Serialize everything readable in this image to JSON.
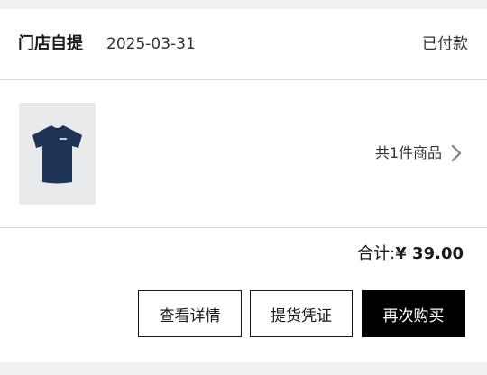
{
  "order": {
    "pickup_type": "门店自提",
    "date": "2025-03-31",
    "status": "已付款",
    "item_count_label": "共1件商品",
    "total_label": "合计:",
    "total_amount": "¥ 39.00",
    "product_image_icon": "navy-tshirt-icon"
  },
  "actions": {
    "view_details": "查看详情",
    "pickup_voucher": "提货凭证",
    "buy_again": "再次购买"
  },
  "colors": {
    "page_background": "#f1f1f3",
    "card_background": "#ffffff",
    "primary_button": "#000000",
    "tshirt": "#1f3557"
  }
}
